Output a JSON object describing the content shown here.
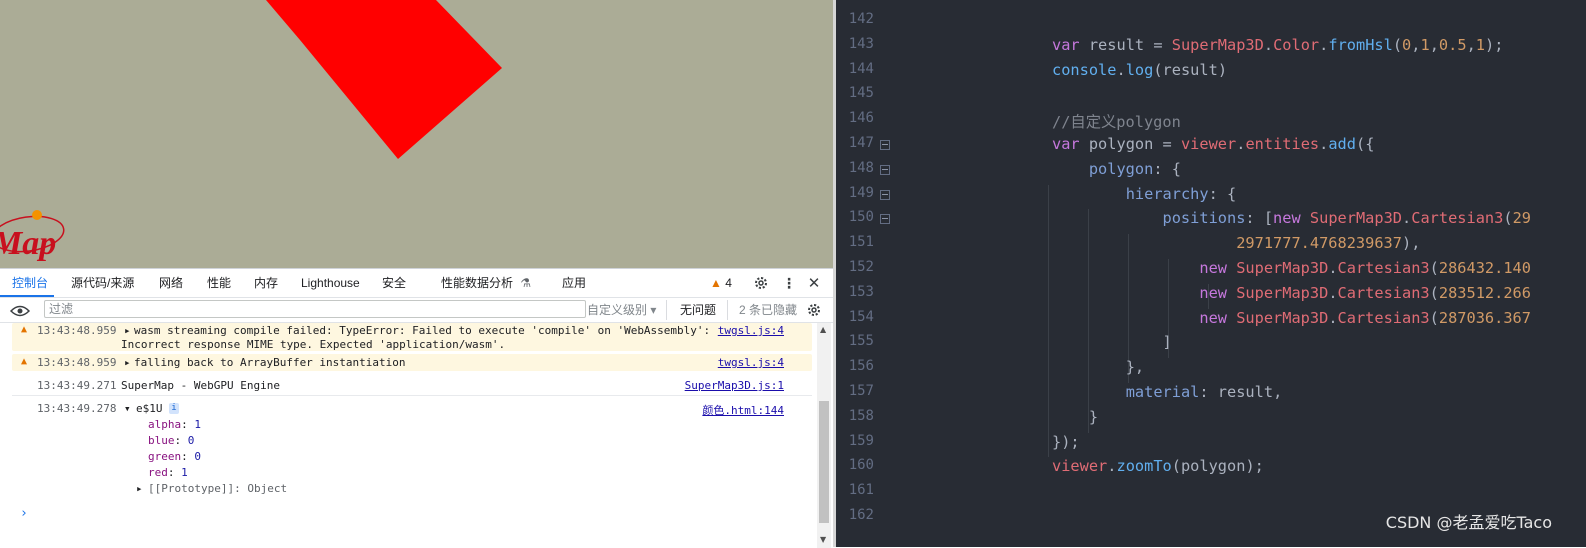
{
  "viewport": {
    "logo_text": "Map",
    "colors": {
      "background": "#abac96",
      "polygon": "#ff0000"
    }
  },
  "devtools": {
    "tabs": [
      "控制台",
      "源代码/来源",
      "网络",
      "性能",
      "内存",
      "Lighthouse",
      "安全",
      "性能数据分析",
      "应用"
    ],
    "active_tab": "控制台",
    "warning_count": "4",
    "filter": {
      "placeholder": "过滤",
      "level_label": "自定义级别 ▾",
      "no_issues": "无问题",
      "hidden": "2 条已隐藏"
    },
    "messages": [
      {
        "type": "warning",
        "time": "13:43:48.959",
        "text": "wasm streaming compile failed: TypeError: Failed to execute 'compile' on 'WebAssembly':",
        "text2": "Incorrect response MIME type. Expected 'application/wasm'.",
        "source": "twgsl.js:4"
      },
      {
        "type": "warning",
        "time": "13:43:48.959",
        "text": "falling back to ArrayBuffer instantiation",
        "source": "twgsl.js:4"
      },
      {
        "type": "log",
        "time": "13:43:49.271",
        "text": "SuperMap - WebGPU Engine",
        "source": "SuperMap3D.js:1"
      },
      {
        "type": "log",
        "time": "13:43:49.278",
        "text": "e$1U",
        "info_badge": "i",
        "source": "颜色.html:144",
        "props": [
          {
            "key": "alpha",
            "value": "1"
          },
          {
            "key": "blue",
            "value": "0"
          },
          {
            "key": "green",
            "value": "0"
          },
          {
            "key": "red",
            "value": "1"
          }
        ],
        "prototype": "[[Prototype]]: Object"
      }
    ],
    "prompt": "›"
  },
  "editor": {
    "lines": [
      {
        "n": "142",
        "tokens": []
      },
      {
        "n": "143",
        "tokens": [
          [
            "kw",
            "var"
          ],
          [
            "plain",
            " result = "
          ],
          [
            "cls",
            "SuperMap3D"
          ],
          [
            "punc",
            "."
          ],
          [
            "cls",
            "Color"
          ],
          [
            "punc",
            "."
          ],
          [
            "fn",
            "fromHsl"
          ],
          [
            "punc",
            "("
          ],
          [
            "num",
            "0"
          ],
          [
            "punc",
            ","
          ],
          [
            "num",
            "1"
          ],
          [
            "punc",
            ","
          ],
          [
            "num",
            "0.5"
          ],
          [
            "punc",
            ","
          ],
          [
            "num",
            "1"
          ],
          [
            "punc",
            ");"
          ]
        ]
      },
      {
        "n": "144",
        "tokens": [
          [
            "fn",
            "console"
          ],
          [
            "punc",
            "."
          ],
          [
            "fn",
            "log"
          ],
          [
            "punc",
            "("
          ],
          [
            "plain",
            "result"
          ],
          [
            "punc",
            ")"
          ]
        ]
      },
      {
        "n": "145",
        "tokens": []
      },
      {
        "n": "146",
        "tokens": [
          [
            "cm",
            "//自定义polygon"
          ]
        ]
      },
      {
        "n": "147",
        "fold": true,
        "tokens": [
          [
            "kw",
            "var"
          ],
          [
            "plain",
            " polygon = "
          ],
          [
            "cls",
            "viewer"
          ],
          [
            "punc",
            "."
          ],
          [
            "cls",
            "entities"
          ],
          [
            "punc",
            "."
          ],
          [
            "fn",
            "add"
          ],
          [
            "punc",
            "({"
          ]
        ]
      },
      {
        "n": "148",
        "fold": true,
        "tokens": [
          [
            "plain",
            "    "
          ],
          [
            "prop",
            "polygon"
          ],
          [
            "punc",
            ": {"
          ]
        ]
      },
      {
        "n": "149",
        "fold": true,
        "tokens": [
          [
            "plain",
            "        "
          ],
          [
            "prop",
            "hierarchy"
          ],
          [
            "punc",
            ": {"
          ]
        ]
      },
      {
        "n": "150",
        "fold": true,
        "tokens": [
          [
            "plain",
            "            "
          ],
          [
            "prop",
            "positions"
          ],
          [
            "punc",
            ": ["
          ],
          [
            "kw",
            "new"
          ],
          [
            "plain",
            " "
          ],
          [
            "cls",
            "SuperMap3D"
          ],
          [
            "punc",
            "."
          ],
          [
            "cls",
            "Cartesian3"
          ],
          [
            "punc",
            "("
          ],
          [
            "num",
            "29"
          ]
        ]
      },
      {
        "n": "151",
        "tokens": [
          [
            "plain",
            "                    "
          ],
          [
            "num",
            "2971777.4768239637"
          ],
          [
            "punc",
            "),"
          ]
        ]
      },
      {
        "n": "152",
        "tokens": [
          [
            "plain",
            "                "
          ],
          [
            "kw",
            "new"
          ],
          [
            "plain",
            " "
          ],
          [
            "cls",
            "SuperMap3D"
          ],
          [
            "punc",
            "."
          ],
          [
            "cls",
            "Cartesian3"
          ],
          [
            "punc",
            "("
          ],
          [
            "num",
            "286432.140"
          ]
        ]
      },
      {
        "n": "153",
        "tokens": [
          [
            "plain",
            "                "
          ],
          [
            "kw",
            "new"
          ],
          [
            "plain",
            " "
          ],
          [
            "cls",
            "SuperMap3D"
          ],
          [
            "punc",
            "."
          ],
          [
            "cls",
            "Cartesian3"
          ],
          [
            "punc",
            "("
          ],
          [
            "num",
            "283512.266"
          ]
        ]
      },
      {
        "n": "154",
        "tokens": [
          [
            "plain",
            "                "
          ],
          [
            "kw",
            "new"
          ],
          [
            "plain",
            " "
          ],
          [
            "cls",
            "SuperMap3D"
          ],
          [
            "punc",
            "."
          ],
          [
            "cls",
            "Cartesian3"
          ],
          [
            "punc",
            "("
          ],
          [
            "num",
            "287036.367"
          ]
        ]
      },
      {
        "n": "155",
        "tokens": [
          [
            "plain",
            "            "
          ],
          [
            "punc",
            "]"
          ]
        ]
      },
      {
        "n": "156",
        "tokens": [
          [
            "plain",
            "        "
          ],
          [
            "punc",
            "},"
          ]
        ]
      },
      {
        "n": "157",
        "tokens": [
          [
            "plain",
            "        "
          ],
          [
            "prop",
            "material"
          ],
          [
            "punc",
            ": "
          ],
          [
            "plain",
            "result"
          ],
          [
            "punc",
            ","
          ]
        ]
      },
      {
        "n": "158",
        "tokens": [
          [
            "plain",
            "    "
          ],
          [
            "punc",
            "}"
          ]
        ]
      },
      {
        "n": "159",
        "tokens": [
          [
            "punc",
            "});"
          ]
        ]
      },
      {
        "n": "160",
        "tokens": [
          [
            "cls",
            "viewer"
          ],
          [
            "punc",
            "."
          ],
          [
            "fn",
            "zoomTo"
          ],
          [
            "punc",
            "("
          ],
          [
            "plain",
            "polygon"
          ],
          [
            "punc",
            ");"
          ]
        ]
      },
      {
        "n": "161",
        "tokens": []
      },
      {
        "n": "162",
        "tokens": []
      }
    ],
    "watermark": "CSDN @老孟爱吃Taco",
    "colors": {
      "background": "#282c34",
      "keyword": "#c678dd",
      "class": "#e06c75",
      "function": "#61afef",
      "number": "#d19a66"
    }
  }
}
